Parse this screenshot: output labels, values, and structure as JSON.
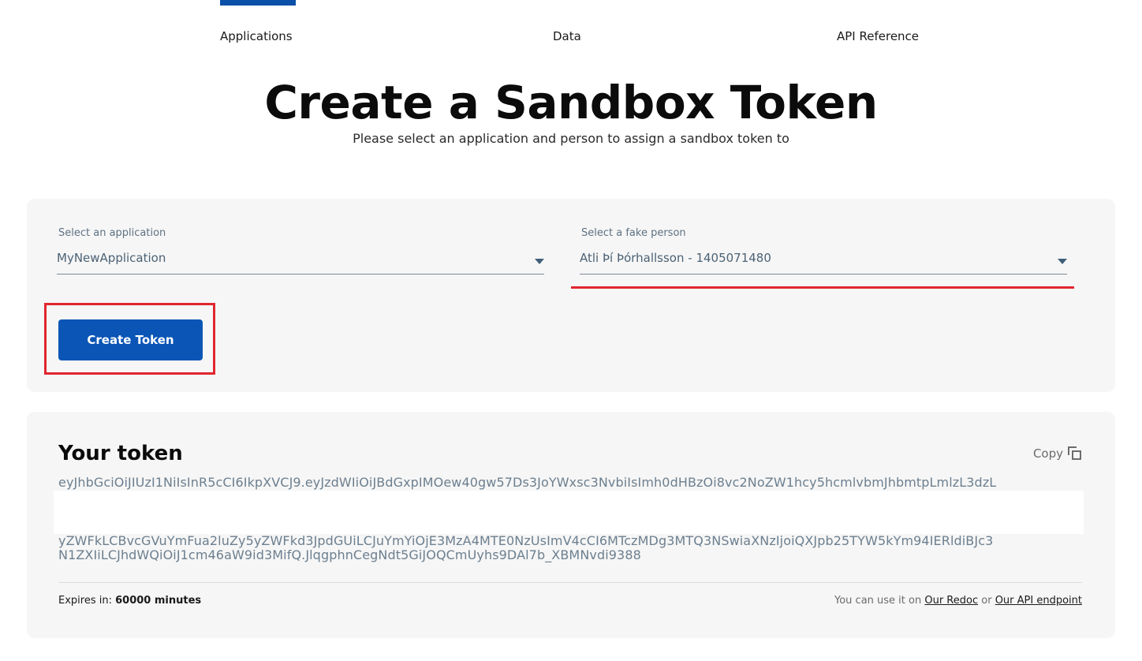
{
  "nav": {
    "items": [
      {
        "label": "Applications",
        "active": true
      },
      {
        "label": "Data"
      },
      {
        "label": "API Reference"
      }
    ],
    "accent_color": "#0a4fa8"
  },
  "header": {
    "title": "Create a Sandbox Token",
    "subtitle": "Please select an application and person to assign a sandbox token to"
  },
  "form": {
    "application": {
      "label": "Select an application",
      "value": "MyNewApplication"
    },
    "person": {
      "label": "Select a fake person",
      "value": "Atli Þí Þórhallsson - 1405071480"
    },
    "create_button": "Create Token",
    "button_color": "#0a55b6",
    "highlight_color": "#e0262e"
  },
  "token": {
    "title": "Your token",
    "copy_label": "Copy",
    "lines": [
      "eyJhbGciOiJIUzI1NiIsInR5cCI6IkpXVCJ9.eyJzdWIiOiJBdGxpIMOew40gw57Ds3JoYWxsc3NvbiIsImh0dHBzOi8vc2NoZW1hcy5hcmlvbmJhbmtpLmlzL3dzL",
      "yZWFkLCBvcGVuYmFua2luZy5yZWFkd3JpdGUiLCJuYmYiOjE3MzA4MTE0NzUsImV4cCI6MTczMDg3MTQ3NSwiaXNzIjoiQXJpb25TYW5kYm94IERldiBJc3",
      "N1ZXIiLCJhdWQiOiJ1cm46aW9id3MifQ.JlqgphnCegNdt5GiJOQCmUyhs9DAl7b_XBMNvdi9388"
    ],
    "expires_label": "Expires in:",
    "expires_value": "60000 minutes",
    "usage_prefix": "You can use it on",
    "usage_link_1": "Our Redoc",
    "usage_or": "or",
    "usage_link_2": "Our API endpoint"
  }
}
